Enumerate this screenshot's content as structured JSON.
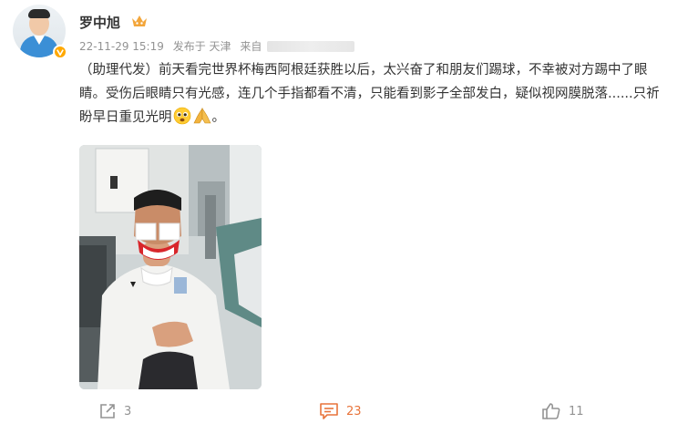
{
  "user": {
    "name": "罗中旭",
    "time": "22-11-29 15:19",
    "published_label": "发布于 天津",
    "source_label": "来自"
  },
  "post": {
    "text": "（助理代发）前天看完世界杯梅西阿根廷获胜以后，太兴奋了和朋友们踢球，不幸被对方踢中了眼睛。受伤后眼睛只有光感，连几个手指都看不清，只能看到影子全部发白，疑似视网膜脱落......只祈盼早日重见光明",
    "end_punct": "。"
  },
  "actions": {
    "share_count": "3",
    "comment_count": "23",
    "like_count": "11"
  },
  "colors": {
    "comment_accent": "#e8743b",
    "verify_badge": "#ffa800"
  },
  "icons": [
    "share-icon",
    "comment-icon",
    "like-icon",
    "vip-crown-icon",
    "verified-icon",
    "pleading-face-emoji",
    "praying-hands-emoji"
  ]
}
